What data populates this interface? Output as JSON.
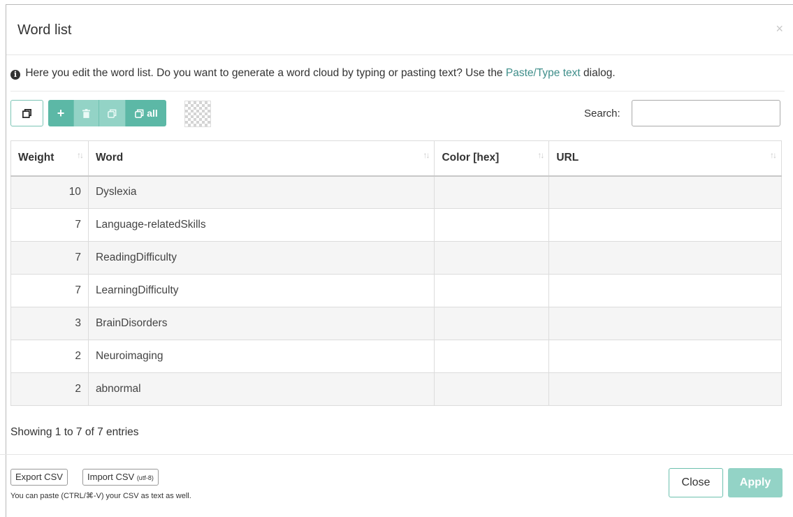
{
  "dialog": {
    "title": "Word list",
    "close_icon": "×",
    "info_icon": "info-circle",
    "info_text_before": "Here you edit the word list. Do you want to generate a word cloud by typing or pasting text? Use the",
    "info_link": "Paste/Type text",
    "info_text_after": "dialog.",
    "accent_color": "#5cb8a6"
  },
  "toolbar": {
    "copy_icon": "copy-icon",
    "add_label": "+",
    "delete_icon": "trash-icon",
    "duplicate_icon": "clone-icon",
    "duplicate_all_label": "all",
    "color_picker_icon": "transparent-color-swatch"
  },
  "search": {
    "label": "Search:",
    "value": ""
  },
  "table": {
    "columns": [
      "Weight",
      "Word",
      "Color [hex]",
      "URL"
    ],
    "rows": [
      {
        "weight": "10",
        "word": "Dyslexia",
        "color": "",
        "url": ""
      },
      {
        "weight": "7",
        "word": "Language-relatedSkills",
        "color": "",
        "url": ""
      },
      {
        "weight": "7",
        "word": "ReadingDifficulty",
        "color": "",
        "url": ""
      },
      {
        "weight": "7",
        "word": "LearningDifficulty",
        "color": "",
        "url": ""
      },
      {
        "weight": "3",
        "word": "BrainDisorders",
        "color": "",
        "url": ""
      },
      {
        "weight": "2",
        "word": "Neuroimaging",
        "color": "",
        "url": ""
      },
      {
        "weight": "2",
        "word": "abnormal",
        "color": "",
        "url": ""
      }
    ],
    "showing": "Showing 1 to 7 of 7 entries"
  },
  "footer": {
    "export_label": "Export CSV",
    "import_label": "Import CSV",
    "import_note": "(utf-8)",
    "hint": "You can paste (CTRL/⌘-V) your CSV as text as well.",
    "close_label": "Close",
    "apply_label": "Apply"
  }
}
